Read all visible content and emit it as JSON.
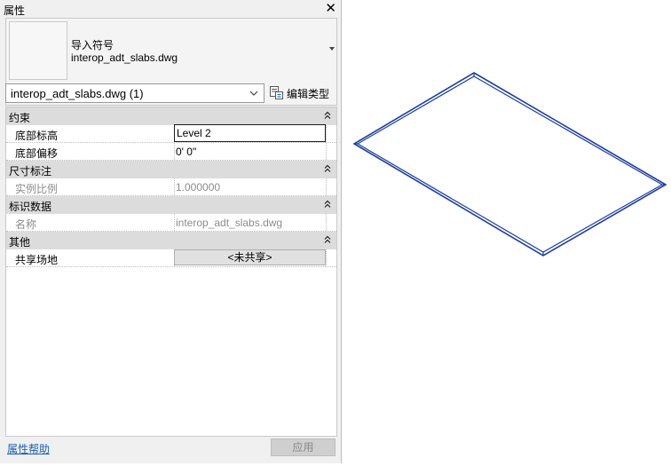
{
  "panel": {
    "title": "属性",
    "close_glyph": "✕",
    "type_selector": {
      "family": "导入符号",
      "type": "interop_adt_slabs.dwg"
    },
    "instance_filter": "interop_adt_slabs.dwg (1)",
    "edit_type_label": "编辑类型",
    "categories": {
      "constraints": {
        "label": "约束",
        "rows": [
          {
            "name": "底部标高",
            "value": "Level 2"
          },
          {
            "name": "底部偏移",
            "value": "0'  0\""
          }
        ]
      },
      "dimensions": {
        "label": "尺寸标注",
        "rows": [
          {
            "name": "实例比例",
            "value": "1.000000"
          }
        ]
      },
      "identity": {
        "label": "标识数据",
        "rows": [
          {
            "name": "名称",
            "value": "interop_adt_slabs.dwg"
          }
        ]
      },
      "other": {
        "label": "其他",
        "rows": [
          {
            "name": "共享场地",
            "value": "<未共享>"
          }
        ]
      }
    },
    "help_link": "属性帮助",
    "apply_label": "应用"
  },
  "colors": {
    "model_edge": "#1f3f9f",
    "link": "#1a5fb4"
  }
}
